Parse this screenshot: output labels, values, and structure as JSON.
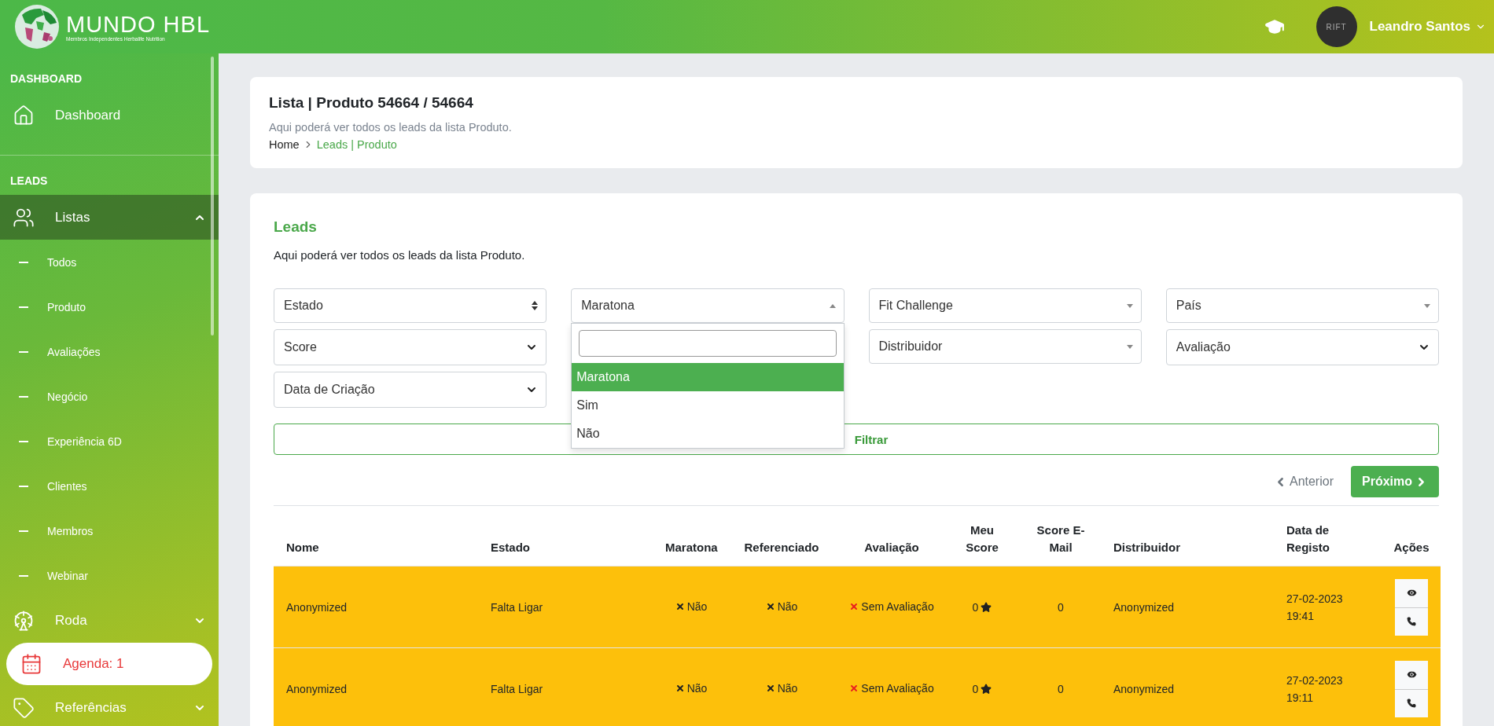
{
  "header": {
    "brand": "MUNDO HBL",
    "tagline": "Membros Independentes Herbalife Nutrition",
    "user": {
      "avatar": "RIFT",
      "name": "Leandro Santos"
    }
  },
  "sidebar": {
    "sections": [
      {
        "title": "DASHBOARD",
        "items": [
          {
            "label": "Dashboard",
            "kind": "link"
          }
        ]
      },
      {
        "title": "LEADS",
        "items": [
          {
            "label": "Listas",
            "kind": "group",
            "expanded": true,
            "children": [
              {
                "label": "Todos"
              },
              {
                "label": "Produto"
              },
              {
                "label": "Avaliações"
              },
              {
                "label": "Negócio"
              },
              {
                "label": "Experiência 6D"
              },
              {
                "label": "Clientes"
              },
              {
                "label": "Membros"
              },
              {
                "label": "Webinar"
              }
            ]
          },
          {
            "label": "Roda",
            "kind": "group",
            "expanded": false
          },
          {
            "label": "Agenda: 1",
            "kind": "alert"
          },
          {
            "label": "Referências",
            "kind": "group",
            "expanded": false
          }
        ]
      }
    ]
  },
  "page_header": {
    "title": "Lista | Produto 54664 / 54664",
    "subtitle": "Aqui poderá ver todos os leads da lista Produto.",
    "breadcrumb": [
      {
        "label": "Home",
        "current": false
      },
      {
        "label": "Leads | Produto",
        "current": true
      }
    ]
  },
  "leads": {
    "title": "Leads",
    "description": "Aqui poderá ver todos os leads da lista Produto.",
    "filter_columns": [
      [
        {
          "label": "Estado",
          "kind": "sort"
        },
        {
          "label": "Score",
          "kind": "native"
        },
        {
          "label": "Data de Criação",
          "kind": "native"
        }
      ],
      [
        {
          "label": "Maratona",
          "kind": "search",
          "open": true,
          "options": [
            {
              "label": "Maratona",
              "selected": true
            },
            {
              "label": "Sim",
              "selected": false
            },
            {
              "label": "Não",
              "selected": false
            }
          ]
        }
      ],
      [
        {
          "label": "Fit Challenge",
          "kind": "search",
          "open": false
        },
        {
          "label": "Distribuidor",
          "kind": "search",
          "open": false
        }
      ],
      [
        {
          "label": "País",
          "kind": "search",
          "open": false
        },
        {
          "label": "Avaliação",
          "kind": "native"
        }
      ]
    ],
    "filter_button": "Filtrar",
    "pagination": [
      {
        "label": "Anterior",
        "kind": "previous",
        "disabled": true
      },
      {
        "label": "Próximo",
        "kind": "next",
        "disabled": false
      }
    ],
    "table": {
      "columns": [
        "Nome",
        "Estado",
        "Maratona",
        "Referenciado",
        "Avaliação",
        "Meu Score",
        "Score E-Mail",
        "Distribuidor",
        "Data de Registo",
        "Ações"
      ],
      "rows": [
        {
          "nome": "Anonymized",
          "estado": "Falta Ligar",
          "maratona": "Não",
          "referenciado": "Não",
          "avaliacao": "Sem Avaliação",
          "meu_score": "0",
          "score_email": "0",
          "distribuidor": "Anonymized",
          "data_registo": "27-02-2023 19:41"
        },
        {
          "nome": "Anonymized",
          "estado": "Falta Ligar",
          "maratona": "Não",
          "referenciado": "Não",
          "avaliacao": "Sem Avaliação",
          "meu_score": "0",
          "score_email": "0",
          "distribuidor": "Anonymized",
          "data_registo": "27-02-2023 19:11"
        }
      ]
    }
  }
}
